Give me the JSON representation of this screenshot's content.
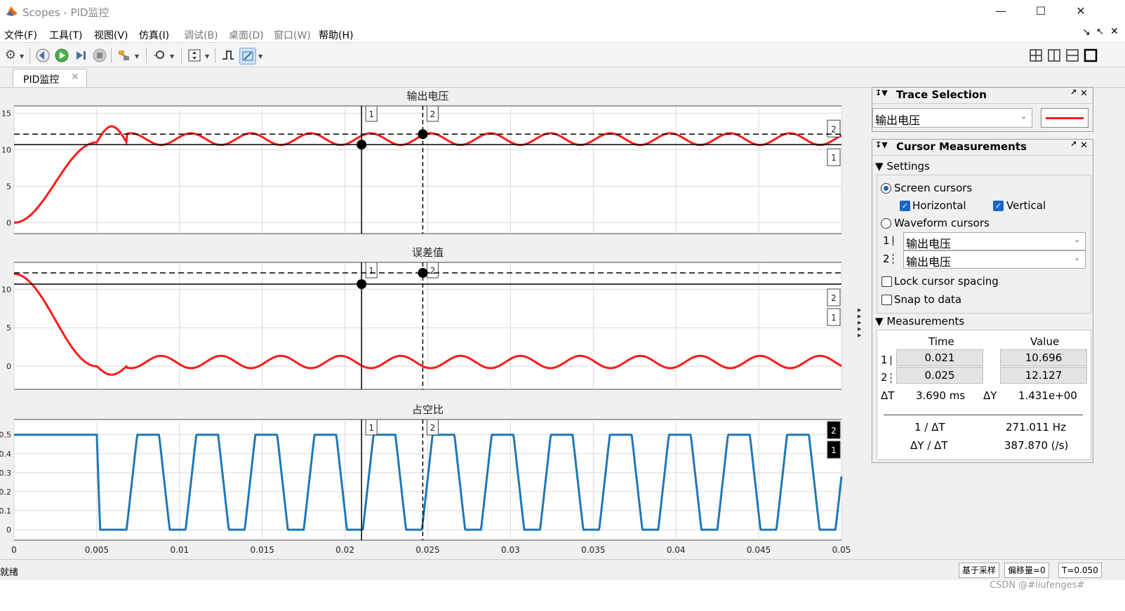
{
  "window": {
    "title": "Scopes - PID监控"
  },
  "menu": [
    "文件(F)",
    "工具(T)",
    "视图(V)",
    "仿真(I)",
    "调试(B)",
    "桌面(D)",
    "窗口(W)",
    "帮助(H)"
  ],
  "tab": {
    "label": "PID监控"
  },
  "colors": {
    "trace_red": "#ff1a1a",
    "trace_blue": "#1f77b4",
    "accent": "#1a66c9"
  },
  "trace_selection": {
    "title": "Trace Selection",
    "selected": "输出电压"
  },
  "cursor_measurements": {
    "title": "Cursor Measurements",
    "settings_label": "Settings",
    "screen_cursors": "Screen cursors",
    "horizontal": "Horizontal",
    "vertical": "Vertical",
    "waveform_cursors": "Waveform cursors",
    "wf1_num": "1",
    "wf1_signal": "输出电压",
    "wf2_num": "2",
    "wf2_signal": "输出电压",
    "lock_spacing": "Lock cursor spacing",
    "snap_to_data": "Snap to data",
    "measurements_label": "Measurements",
    "col_time": "Time",
    "col_value": "Value",
    "row1_num": "1",
    "row1_time": "0.021",
    "row1_value": "10.696",
    "row2_num": "2",
    "row2_time": "0.025",
    "row2_value": "12.127",
    "dt_label": "ΔT",
    "dt_value": "3.690 ms",
    "dy_label": "ΔY",
    "dy_value": "1.431e+00",
    "inv_dt_label": "1 / ΔT",
    "inv_dt_value": "271.011 Hz",
    "dydt_label": "ΔY / ΔT",
    "dydt_value": "387.870 (/s)"
  },
  "status": {
    "left": "就绪",
    "mode": "基于采样",
    "offset": "偏移量=0",
    "time": "T=0.050"
  },
  "watermark": "CSDN @#liufenges#",
  "chart_data": [
    {
      "type": "line",
      "title": "输出电压",
      "xlim": [
        0,
        0.05
      ],
      "ylim": [
        -1.5,
        16
      ],
      "yticks": [
        0,
        5,
        10,
        15
      ],
      "cursors": {
        "t1": 0.021,
        "t2": 0.0247,
        "y1": 10.696,
        "y2": 12.127
      },
      "series": [
        {
          "color": "#ff1a1a",
          "kind": "voltage"
        }
      ]
    },
    {
      "type": "line",
      "title": "误差值",
      "xlim": [
        0,
        0.05
      ],
      "ylim": [
        -3,
        13.5
      ],
      "yticks": [
        0,
        5,
        10
      ],
      "cursors": {
        "t1": 0.021,
        "t2": 0.0247,
        "y1": 10.696,
        "y2": 12.127
      },
      "series": [
        {
          "color": "#ff1a1a",
          "kind": "error"
        }
      ]
    },
    {
      "type": "line",
      "title": "占空比",
      "xlim": [
        0,
        0.05
      ],
      "ylim": [
        -0.055,
        0.58
      ],
      "yticks": [
        0,
        0.1,
        0.2,
        0.3,
        0.4,
        0.5
      ],
      "xticks": [
        0,
        0.005,
        0.01,
        0.015,
        0.02,
        0.025,
        0.03,
        0.035,
        0.04,
        0.045,
        0.05
      ],
      "cursors": {
        "t1": 0.021,
        "t2": 0.0247
      },
      "series": [
        {
          "color": "#1f77b4",
          "kind": "duty"
        }
      ]
    }
  ]
}
